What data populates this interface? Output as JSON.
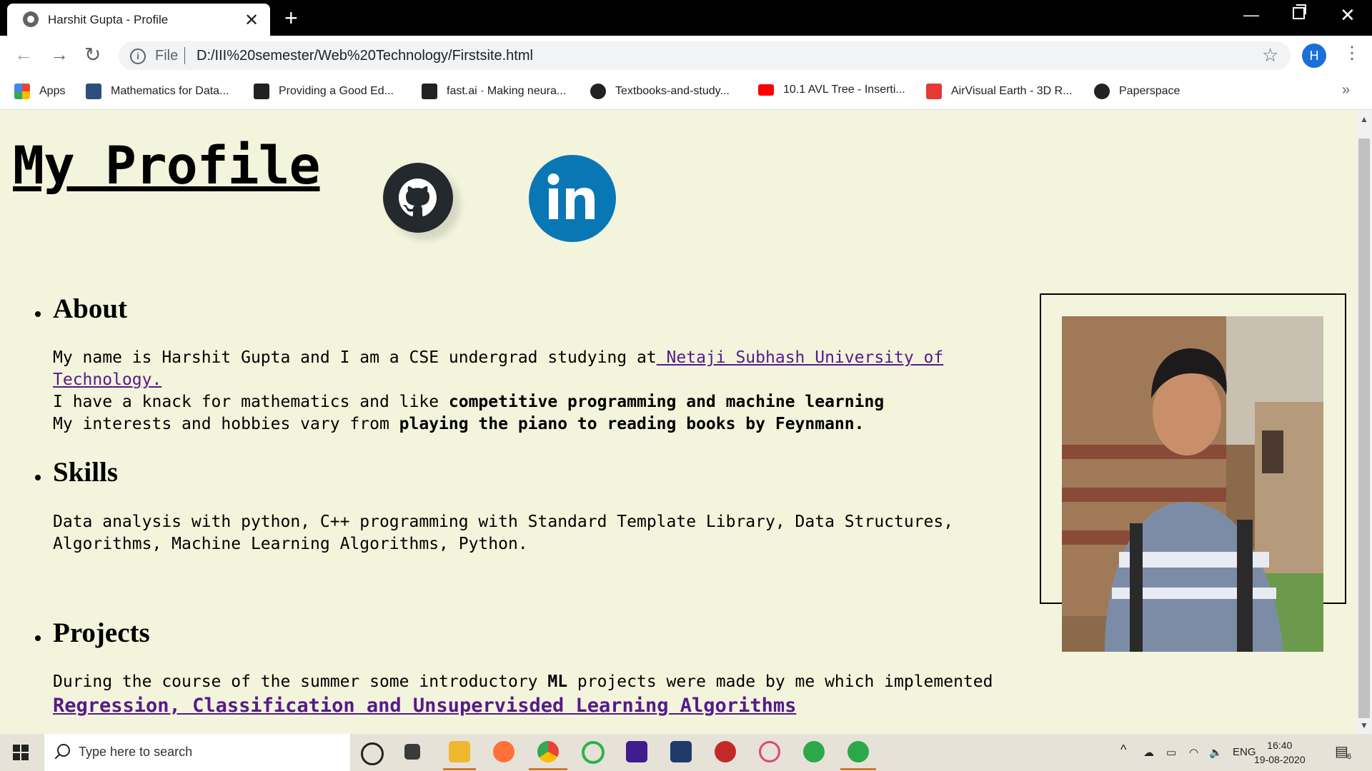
{
  "browser": {
    "tab_title": "Harshit Gupta - Profile",
    "scheme": "File",
    "url": "D:/III%20semester/Web%20Technology/Firstsite.html",
    "profile_initial": "H",
    "bookmarks": [
      {
        "label": "Apps",
        "icon": "apps-grid-icon",
        "color": "#4285f4"
      },
      {
        "label": "Mathematics for Data...",
        "icon": "tds-icon",
        "color": "#2d4f7c"
      },
      {
        "label": "Providing a Good Ed...",
        "icon": "h-icon",
        "color": "#222222"
      },
      {
        "label": "fast.ai · Making neura...",
        "icon": "h-icon",
        "color": "#222222"
      },
      {
        "label": "Textbooks-and-study...",
        "icon": "github-icon",
        "color": "#222222"
      },
      {
        "label": "10.1 AVL Tree - Inserti...",
        "icon": "youtube-icon",
        "color": "#ff0000"
      },
      {
        "label": "AirVisual Earth - 3D R...",
        "icon": "swiss-icon",
        "color": "#e53935"
      },
      {
        "label": "Paperspace",
        "icon": "paperspace-icon",
        "color": "#222222"
      }
    ]
  },
  "profile": {
    "title": "My Profile ",
    "about_heading": "About",
    "about_line1_text": "My name is Harshit Gupta and I am a CSE undergrad studying at",
    "about_link_part1": " Netaji Subhash University of",
    "about_link_part2": "Technology.",
    "about_line2_text": "I have a knack for mathematics and like ",
    "about_line2_bold": "competitive programming and machine learning",
    "about_line3_text": "My interests and hobbies vary from ",
    "about_line3_bold": "playing the piano to reading books by Feynmann.",
    "skills_heading": "Skills",
    "skills_line1": "Data analysis with python, C++ programming with Standard Template Library, Data Structures,",
    "skills_line2": "Algorithms, Machine Learning Algorithms, Python.",
    "projects_heading": "Projects",
    "projects_text1": "During the course of the summer some introductory ",
    "projects_bold": "ML",
    "projects_text2": " projects were made by me which implemented",
    "projects_link": "Regression, Classification and Unsupervisded Learning Algorithms"
  },
  "taskbar": {
    "search_placeholder": "Type here to search",
    "language": "ENG",
    "time": "16:40",
    "date": "19-08-2020",
    "notification_count": "6"
  }
}
